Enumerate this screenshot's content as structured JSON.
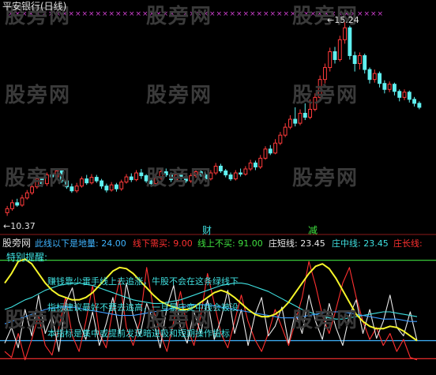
{
  "header": {
    "title": "平安银行(日线)"
  },
  "watermark": "股旁网",
  "upper_chart": {
    "high_label": "←15.24",
    "low_label": "←10.37",
    "markers": [
      "财",
      "减"
    ]
  },
  "indicator": {
    "name": "股旁网",
    "labels": [
      {
        "text": "此线以下是地量: 24.00",
        "color": "#3fb4ff"
      },
      {
        "text": "线下需买: 9.00",
        "color": "#ff3030"
      },
      {
        "text": "线上不买: 91.00",
        "color": "#3fe03f"
      },
      {
        "text": "庄短线: 23.45",
        "color": "#e8e8e8"
      },
      {
        "text": "庄中线: 23.45",
        "color": "#3fe0e0"
      },
      {
        "text": "庄长线:",
        "color": "#ff3030"
      }
    ],
    "notes": [
      "特别提醒:",
      "赚钱靠少雷手线上去追涨，牛股不会在这条绿线下",
      "指标建议最好不要去追高，一旦暴庄变中线会被没",
      "本指标是集中或提前发现暗进吸和短期操作指标"
    ]
  },
  "chart_data": [
    {
      "type": "candlestick",
      "title": "平安银行(日线)",
      "annotations": [
        "15.24",
        "10.37"
      ],
      "candles": [
        {
          "o": 10.45,
          "c": 10.55,
          "h": 10.62,
          "l": 10.37
        },
        {
          "o": 10.55,
          "c": 10.7,
          "h": 10.78,
          "l": 10.5
        },
        {
          "o": 10.7,
          "c": 10.64,
          "h": 10.8,
          "l": 10.6
        },
        {
          "o": 10.64,
          "c": 10.82,
          "h": 10.9,
          "l": 10.6
        },
        {
          "o": 10.82,
          "c": 10.95,
          "h": 11.02,
          "l": 10.78
        },
        {
          "o": 10.95,
          "c": 11.1,
          "h": 11.18,
          "l": 10.9
        },
        {
          "o": 11.1,
          "c": 11.3,
          "h": 11.38,
          "l": 11.05
        },
        {
          "o": 11.3,
          "c": 11.18,
          "h": 11.35,
          "l": 11.1
        },
        {
          "o": 11.18,
          "c": 11.4,
          "h": 11.46,
          "l": 11.12
        },
        {
          "o": 11.4,
          "c": 11.35,
          "h": 11.48,
          "l": 11.25
        },
        {
          "o": 11.35,
          "c": 11.5,
          "h": 11.56,
          "l": 11.3
        },
        {
          "o": 11.5,
          "c": 11.25,
          "h": 11.55,
          "l": 11.2
        },
        {
          "o": 11.25,
          "c": 11.1,
          "h": 11.3,
          "l": 11.05
        },
        {
          "o": 11.1,
          "c": 11.0,
          "h": 11.18,
          "l": 10.95
        },
        {
          "o": 11.0,
          "c": 11.12,
          "h": 11.2,
          "l": 10.95
        },
        {
          "o": 11.12,
          "c": 11.3,
          "h": 11.36,
          "l": 11.08
        },
        {
          "o": 11.3,
          "c": 11.2,
          "h": 11.4,
          "l": 11.15
        },
        {
          "o": 11.2,
          "c": 11.34,
          "h": 11.42,
          "l": 11.16
        },
        {
          "o": 11.34,
          "c": 11.25,
          "h": 11.4,
          "l": 11.2
        },
        {
          "o": 11.25,
          "c": 11.12,
          "h": 11.3,
          "l": 11.05
        },
        {
          "o": 11.12,
          "c": 11.02,
          "h": 11.18,
          "l": 10.96
        },
        {
          "o": 11.02,
          "c": 11.15,
          "h": 11.22,
          "l": 10.98
        },
        {
          "o": 11.15,
          "c": 11.05,
          "h": 11.2,
          "l": 10.98
        },
        {
          "o": 11.05,
          "c": 11.22,
          "h": 11.28,
          "l": 11.0
        },
        {
          "o": 11.22,
          "c": 11.35,
          "h": 11.42,
          "l": 11.18
        },
        {
          "o": 11.35,
          "c": 11.28,
          "h": 11.44,
          "l": 11.22
        },
        {
          "o": 11.28,
          "c": 11.45,
          "h": 11.52,
          "l": 11.24
        },
        {
          "o": 11.45,
          "c": 11.38,
          "h": 11.55,
          "l": 11.3
        },
        {
          "o": 11.38,
          "c": 11.25,
          "h": 11.42,
          "l": 11.2
        },
        {
          "o": 11.25,
          "c": 11.18,
          "h": 11.3,
          "l": 11.1
        },
        {
          "o": 11.18,
          "c": 11.32,
          "h": 11.38,
          "l": 11.14
        },
        {
          "o": 11.32,
          "c": 11.48,
          "h": 11.55,
          "l": 11.28
        },
        {
          "o": 11.48,
          "c": 11.4,
          "h": 11.56,
          "l": 11.35
        },
        {
          "o": 11.4,
          "c": 11.28,
          "h": 11.46,
          "l": 11.22
        },
        {
          "o": 11.28,
          "c": 11.4,
          "h": 11.48,
          "l": 11.24
        },
        {
          "o": 11.4,
          "c": 11.35,
          "h": 11.46,
          "l": 11.28
        },
        {
          "o": 11.35,
          "c": 11.25,
          "h": 11.4,
          "l": 11.2
        },
        {
          "o": 11.25,
          "c": 11.38,
          "h": 11.44,
          "l": 11.2
        },
        {
          "o": 11.38,
          "c": 11.48,
          "h": 11.55,
          "l": 11.33
        },
        {
          "o": 11.48,
          "c": 11.4,
          "h": 11.54,
          "l": 11.35
        },
        {
          "o": 11.4,
          "c": 11.3,
          "h": 11.45,
          "l": 11.25
        },
        {
          "o": 11.3,
          "c": 11.45,
          "h": 11.52,
          "l": 11.26
        },
        {
          "o": 11.45,
          "c": 11.62,
          "h": 11.7,
          "l": 11.4
        },
        {
          "o": 11.62,
          "c": 11.5,
          "h": 11.68,
          "l": 11.45
        },
        {
          "o": 11.5,
          "c": 11.4,
          "h": 11.55,
          "l": 11.34
        },
        {
          "o": 11.4,
          "c": 11.3,
          "h": 11.46,
          "l": 11.25
        },
        {
          "o": 11.3,
          "c": 11.45,
          "h": 11.52,
          "l": 11.26
        },
        {
          "o": 11.45,
          "c": 11.42,
          "h": 11.56,
          "l": 11.36
        },
        {
          "o": 11.42,
          "c": 11.55,
          "h": 11.62,
          "l": 11.38
        },
        {
          "o": 11.55,
          "c": 11.7,
          "h": 11.78,
          "l": 11.5
        },
        {
          "o": 11.7,
          "c": 11.6,
          "h": 11.76,
          "l": 11.52
        },
        {
          "o": 11.6,
          "c": 11.82,
          "h": 11.9,
          "l": 11.55
        },
        {
          "o": 11.82,
          "c": 12.05,
          "h": 12.12,
          "l": 11.78
        },
        {
          "o": 12.05,
          "c": 11.95,
          "h": 12.15,
          "l": 11.9
        },
        {
          "o": 11.95,
          "c": 12.2,
          "h": 12.3,
          "l": 11.92
        },
        {
          "o": 12.2,
          "c": 12.4,
          "h": 12.48,
          "l": 12.15
        },
        {
          "o": 12.4,
          "c": 12.6,
          "h": 12.7,
          "l": 12.35
        },
        {
          "o": 12.6,
          "c": 12.8,
          "h": 12.9,
          "l": 12.55
        },
        {
          "o": 12.8,
          "c": 12.7,
          "h": 13.1,
          "l": 12.62
        },
        {
          "o": 12.7,
          "c": 12.95,
          "h": 13.05,
          "l": 12.65
        },
        {
          "o": 12.95,
          "c": 12.85,
          "h": 13.2,
          "l": 12.78
        },
        {
          "o": 12.85,
          "c": 13.05,
          "h": 13.3,
          "l": 12.8
        },
        {
          "o": 13.05,
          "c": 13.35,
          "h": 13.45,
          "l": 13.0
        },
        {
          "o": 13.35,
          "c": 13.8,
          "h": 13.9,
          "l": 13.3
        },
        {
          "o": 13.8,
          "c": 14.1,
          "h": 14.2,
          "l": 13.7
        },
        {
          "o": 14.1,
          "c": 14.5,
          "h": 14.6,
          "l": 14.0
        },
        {
          "o": 14.5,
          "c": 14.3,
          "h": 14.62,
          "l": 14.2
        },
        {
          "o": 14.3,
          "c": 14.8,
          "h": 14.9,
          "l": 14.25
        },
        {
          "o": 14.8,
          "c": 15.1,
          "h": 15.24,
          "l": 14.7
        },
        {
          "o": 15.1,
          "c": 14.4,
          "h": 15.15,
          "l": 14.3
        },
        {
          "o": 14.4,
          "c": 14.2,
          "h": 14.5,
          "l": 14.0
        },
        {
          "o": 14.2,
          "c": 14.4,
          "h": 14.48,
          "l": 14.05
        },
        {
          "o": 14.4,
          "c": 14.05,
          "h": 14.45,
          "l": 13.95
        },
        {
          "o": 14.05,
          "c": 13.8,
          "h": 14.1,
          "l": 13.7
        },
        {
          "o": 13.8,
          "c": 13.95,
          "h": 14.05,
          "l": 13.72
        },
        {
          "o": 13.95,
          "c": 13.7,
          "h": 14.0,
          "l": 13.6
        },
        {
          "o": 13.7,
          "c": 13.55,
          "h": 13.78,
          "l": 13.45
        },
        {
          "o": 13.55,
          "c": 13.68,
          "h": 13.75,
          "l": 13.48
        },
        {
          "o": 13.68,
          "c": 13.5,
          "h": 13.72,
          "l": 13.4
        },
        {
          "o": 13.5,
          "c": 13.35,
          "h": 13.55,
          "l": 13.25
        },
        {
          "o": 13.35,
          "c": 13.48,
          "h": 13.55,
          "l": 13.28
        },
        {
          "o": 13.48,
          "c": 13.3,
          "h": 13.52,
          "l": 13.22
        },
        {
          "o": 13.3,
          "c": 13.2,
          "h": 13.36,
          "l": 13.12
        },
        {
          "o": 13.2,
          "c": 13.1,
          "h": 13.25,
          "l": 13.05
        }
      ],
      "ylim": [
        10.2,
        15.6
      ]
    },
    {
      "type": "line",
      "title": "股旁网",
      "ylim": [
        0,
        100
      ],
      "reference_lines": [
        {
          "name": "线上不买",
          "value": 91
        },
        {
          "name": "此线以下是地量",
          "value": 24
        },
        {
          "name": "线下需买",
          "value": 9
        }
      ],
      "series": [
        {
          "name": "庄短线",
          "color": "#e8e8e8",
          "values": [
            22,
            35,
            18,
            50,
            28,
            62,
            30,
            45,
            15,
            55,
            68,
            40,
            25,
            48,
            20,
            38,
            60,
            30,
            72,
            45,
            28,
            55,
            40,
            18,
            52,
            70,
            35,
            22,
            48,
            30,
            58,
            25,
            42,
            66,
            30,
            50,
            20,
            45,
            60,
            28,
            36,
            52,
            22,
            48,
            30,
            62,
            40,
            25,
            55,
            35,
            20,
            45,
            58,
            30,
            50,
            26,
            40,
            62,
            35,
            28,
            48,
            24
          ]
        },
        {
          "name": "庄中线",
          "color": "#3fe0e0",
          "values": [
            50,
            52,
            55,
            58,
            60,
            63,
            66,
            68,
            70,
            71,
            72,
            72,
            71,
            70,
            68,
            66,
            64,
            62,
            60,
            58,
            57,
            56,
            55,
            55,
            56,
            57,
            58,
            60,
            62,
            64,
            66,
            68,
            70,
            71,
            72,
            72,
            71,
            69,
            67,
            65,
            62,
            59,
            56,
            53,
            50,
            48,
            46,
            44,
            43,
            42,
            42,
            43,
            44,
            45,
            46,
            47,
            48,
            48,
            47,
            46,
            45,
            44
          ]
        },
        {
          "name": "庄长线",
          "color": "#ff3030",
          "values": [
            15,
            10,
            30,
            8,
            25,
            45,
            20,
            12,
            35,
            60,
            28,
            15,
            40,
            70,
            30,
            18,
            50,
            75,
            35,
            20,
            40,
            85,
            50,
            30,
            15,
            40,
            65,
            35,
            20,
            45,
            80,
            55,
            30,
            18,
            40,
            62,
            40,
            25,
            15,
            30,
            50,
            35,
            20,
            40,
            60,
            90,
            70,
            45,
            30,
            50,
            72,
            85,
            60,
            40,
            25,
            35,
            20,
            30,
            15,
            25,
            10,
            8
          ]
        },
        {
          "name": "",
          "color": "#f5f52a",
          "values": [
            72,
            80,
            90,
            92,
            88,
            80,
            72,
            66,
            62,
            60,
            58,
            58,
            60,
            64,
            70,
            76,
            82,
            85,
            84,
            80,
            74,
            68,
            62,
            57,
            54,
            52,
            50,
            50,
            52,
            56,
            60,
            64,
            66,
            64,
            60,
            55,
            50,
            46,
            44,
            44,
            46,
            50,
            56,
            64,
            72,
            80,
            86,
            88,
            84,
            76,
            66,
            56,
            46,
            40,
            36,
            34,
            34,
            36,
            35,
            32,
            28,
            24
          ]
        },
        {
          "name": "",
          "color": "#3b9bff",
          "values": [
            38,
            40,
            42,
            44,
            46,
            48,
            50,
            51,
            52,
            52,
            52,
            51,
            50,
            49,
            48,
            47,
            46,
            45,
            45,
            45,
            46,
            47,
            48,
            49,
            50,
            51,
            52,
            53,
            54,
            54,
            54,
            53,
            52,
            51,
            50,
            49,
            48,
            47,
            46,
            45,
            44,
            43,
            43,
            43,
            44,
            45,
            46,
            47,
            48,
            48,
            48,
            47,
            46,
            45,
            44,
            43,
            42,
            42,
            42,
            41,
            40,
            40
          ]
        }
      ]
    }
  ]
}
